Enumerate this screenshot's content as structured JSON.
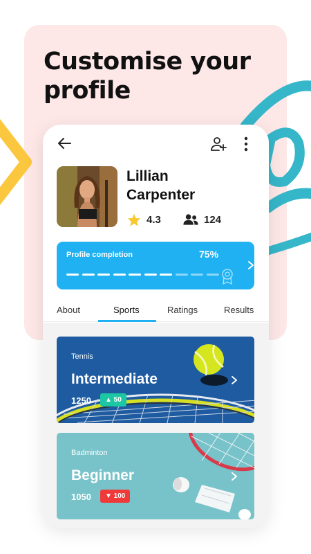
{
  "headline": "Customise your profile",
  "colors": {
    "accent": "#1fb1f2",
    "panel": "#fde7e7",
    "positive": "#1ec7a3",
    "negative": "#f03a3a",
    "deco_yellow": "#fbc73f",
    "deco_teal": "#36b6c9"
  },
  "topbar": {
    "back_icon": "arrow-left-icon",
    "add_friend_icon": "user-plus-icon",
    "more_icon": "more-vertical-icon"
  },
  "profile": {
    "first_name": "Lillian",
    "last_name": "Carpenter",
    "rating": "4.3",
    "friends": "124"
  },
  "completion": {
    "label": "Profile completion",
    "percent_text": "75%",
    "percent": 75
  },
  "tabs": [
    {
      "label": "About"
    },
    {
      "label": "Sports"
    },
    {
      "label": "Ratings"
    },
    {
      "label": "Results"
    }
  ],
  "active_tab": "Sports",
  "sports": [
    {
      "sport": "Tennis",
      "level": "Intermediate",
      "score": "1250",
      "change": "▲ 50",
      "trend": "up"
    },
    {
      "sport": "Badminton",
      "level": "Beginner",
      "score": "1050",
      "change": "▼ 100",
      "trend": "down"
    }
  ]
}
